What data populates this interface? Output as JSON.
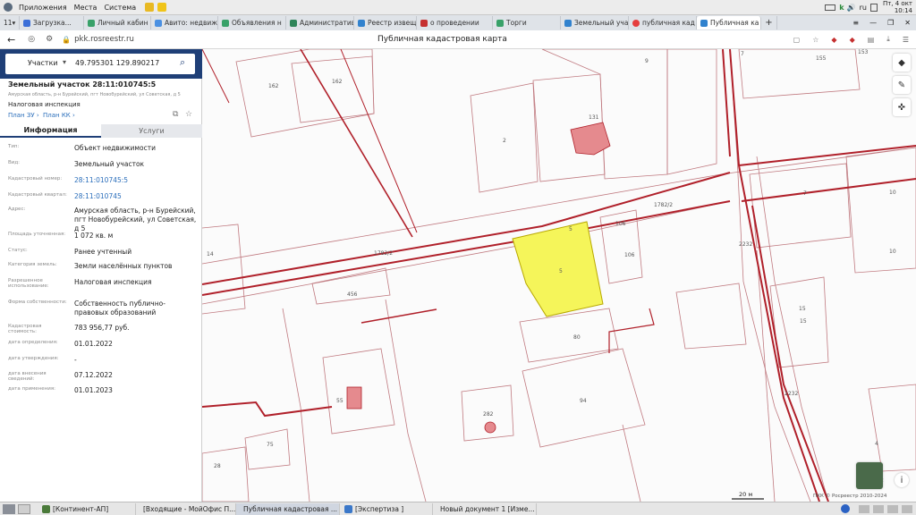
{
  "os_bar": {
    "menus": [
      "Приложения",
      "Места",
      "Система"
    ],
    "date": "Пт, 4 окт",
    "time": "10:14",
    "lang": "ru"
  },
  "tabs": [
    {
      "label": "11",
      "color": "#8a8f98"
    },
    {
      "label": "Загрузка...",
      "color": "#3c6fd8"
    },
    {
      "label": "Личный кабин",
      "color": "#38a169"
    },
    {
      "label": "Авито: недвиж",
      "color": "#4a90e2"
    },
    {
      "label": "Объявления н",
      "color": "#38a169"
    },
    {
      "label": "Административ",
      "color": "#2f855a"
    },
    {
      "label": "Реестр извеще",
      "color": "#3182ce"
    },
    {
      "label": "о проведении",
      "color": "#c53030"
    },
    {
      "label": "Торги",
      "color": "#38a169"
    },
    {
      "label": "Земельный уча",
      "color": "#3182ce"
    },
    {
      "label": "публичная кад",
      "color": "#e53e3e"
    },
    {
      "label": "Публичная ка",
      "color": "#3182ce",
      "active": true
    }
  ],
  "address": {
    "url": "pkk.rosreestr.ru",
    "page_title": "Публичная кадастровая карта"
  },
  "search": {
    "category": "Участки",
    "query": "49.795301 129.890217"
  },
  "parcel": {
    "title": "Земельный участок 28:11:010745:5",
    "subtitle": "Амурская область, р-н Бурейский, пгт Новобурейский, ул Советская, д 5",
    "name": "Налоговая инспекция",
    "link_plan_zu": "План ЗУ",
    "link_plan_kk": "План КК"
  },
  "panel_tabs": {
    "info": "Информация",
    "services": "Услуги"
  },
  "attributes": [
    {
      "label": "Тип:",
      "value": "Объект недвижимости",
      "link": false
    },
    {
      "label": "Вид:",
      "value": "Земельный участок",
      "link": false
    },
    {
      "label": "Кадастровый номер:",
      "value": "28:11:010745:5",
      "link": true
    },
    {
      "label": "Кадастровый квартал:",
      "value": "28:11:010745",
      "link": true
    },
    {
      "label": "Адрес:",
      "value": "Амурская область, р-н Бурейский, пгт Новобурейский, ул Советская, д 5",
      "link": false
    },
    {
      "label": "Площадь уточненная:",
      "value": "1 072 кв. м",
      "link": false
    },
    {
      "label": "Статус:",
      "value": "Ранее учтенный",
      "link": false
    },
    {
      "label": "Категория земель:",
      "value": "Земли населённых пунктов",
      "link": false
    },
    {
      "label": "Разрешенное использование:",
      "value": "Налоговая инспекция",
      "link": false
    },
    {
      "label": "Форма собственности:",
      "value": "Собственность публично-правовых образований",
      "link": false
    },
    {
      "label": "Кадастровая стоимость:",
      "value": "783 956,77 руб.",
      "link": false
    },
    {
      "label": "дата определения:",
      "value": "01.01.2022",
      "link": false
    },
    {
      "label": "дата утверждения:",
      "value": "-",
      "link": false
    },
    {
      "label": "дата внесения сведений:",
      "value": "07.12.2022",
      "link": false
    },
    {
      "label": "дата применения:",
      "value": "01.01.2023",
      "link": false
    }
  ],
  "map": {
    "labels": [
      "162",
      "162",
      "9",
      "7",
      "155",
      "153",
      "131",
      "2",
      "10",
      "7",
      "10",
      "1782/2",
      "1782/2",
      "2232",
      "106",
      "106",
      "5",
      "5",
      "14",
      "456",
      "15",
      "15",
      "80",
      "55",
      "282",
      "94",
      "75",
      "28",
      "2232",
      "4",
      "2"
    ],
    "scale": "20 м",
    "copyright": "ПКК © Росреестр 2010-2024",
    "selected_color": "#f5f55a",
    "boundary_color": "#b0202a"
  },
  "taskbar": [
    {
      "label": "[Континент-АП]",
      "color": "#4a7a3a"
    },
    {
      "label": "[Входящие - МойОфис П...",
      "color": "#d68a1c"
    },
    {
      "label": "Публичная кадастровая ...",
      "color": "#2b62c4",
      "active": true
    },
    {
      "label": "[Экспертиза ]",
      "color": "#3b78c9"
    },
    {
      "label": "Новый документ 1 [Изме...",
      "color": "#2d8a5a"
    }
  ]
}
